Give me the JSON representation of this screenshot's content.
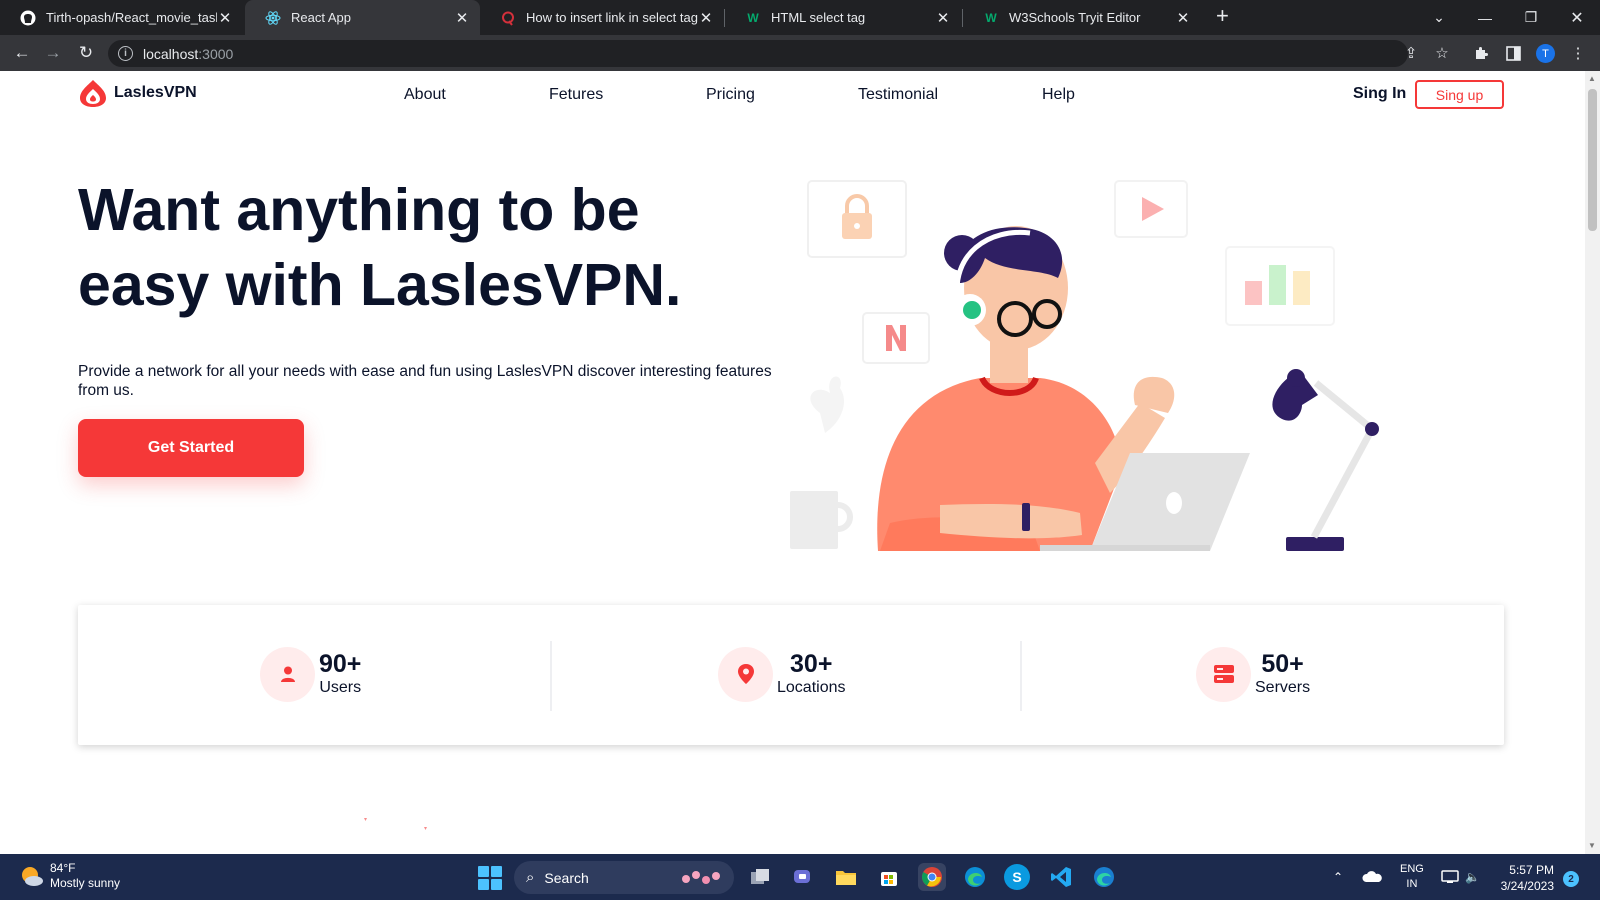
{
  "browser": {
    "tabs": [
      {
        "title": "Tirth-opash/React_movie_task",
        "icon": "github-icon"
      },
      {
        "title": "React App",
        "icon": "react-icon"
      },
      {
        "title": "How to insert link in select tag in",
        "icon": "quora-icon"
      },
      {
        "title": "HTML select tag",
        "icon": "w3schools-icon"
      },
      {
        "title": "W3Schools Tryit Editor",
        "icon": "w3schools-icon"
      }
    ],
    "url_host": "localhost",
    "url_port": ":3000",
    "profile_initial": "T"
  },
  "site": {
    "brand": "LaslesVPN",
    "nav": [
      "About",
      "Fetures",
      "Pricing",
      "Testimonial",
      "Help"
    ],
    "sign_in": "Sing In",
    "sign_up": "Sing up",
    "hero": {
      "title_part1": "Want anything to be easy with ",
      "title_bold": "LaslesVPN.",
      "subtitle": "Provide a network for all your needs with ease and fun using LaslesVPN discover interesting features from us.",
      "cta": "Get Started"
    },
    "stats": [
      {
        "value": "90+",
        "label": "Users",
        "icon": "user-icon"
      },
      {
        "value": "30+",
        "label": "Locations",
        "icon": "location-pin-icon"
      },
      {
        "value": "50+",
        "label": "Servers",
        "icon": "server-icon"
      }
    ],
    "accent_color": "#f53838"
  },
  "taskbar": {
    "temperature": "84°F",
    "condition": "Mostly sunny",
    "search": "Search",
    "language": "ENG",
    "region": "IN",
    "time": "5:57 PM",
    "date": "3/24/2023",
    "notifications": "2"
  }
}
